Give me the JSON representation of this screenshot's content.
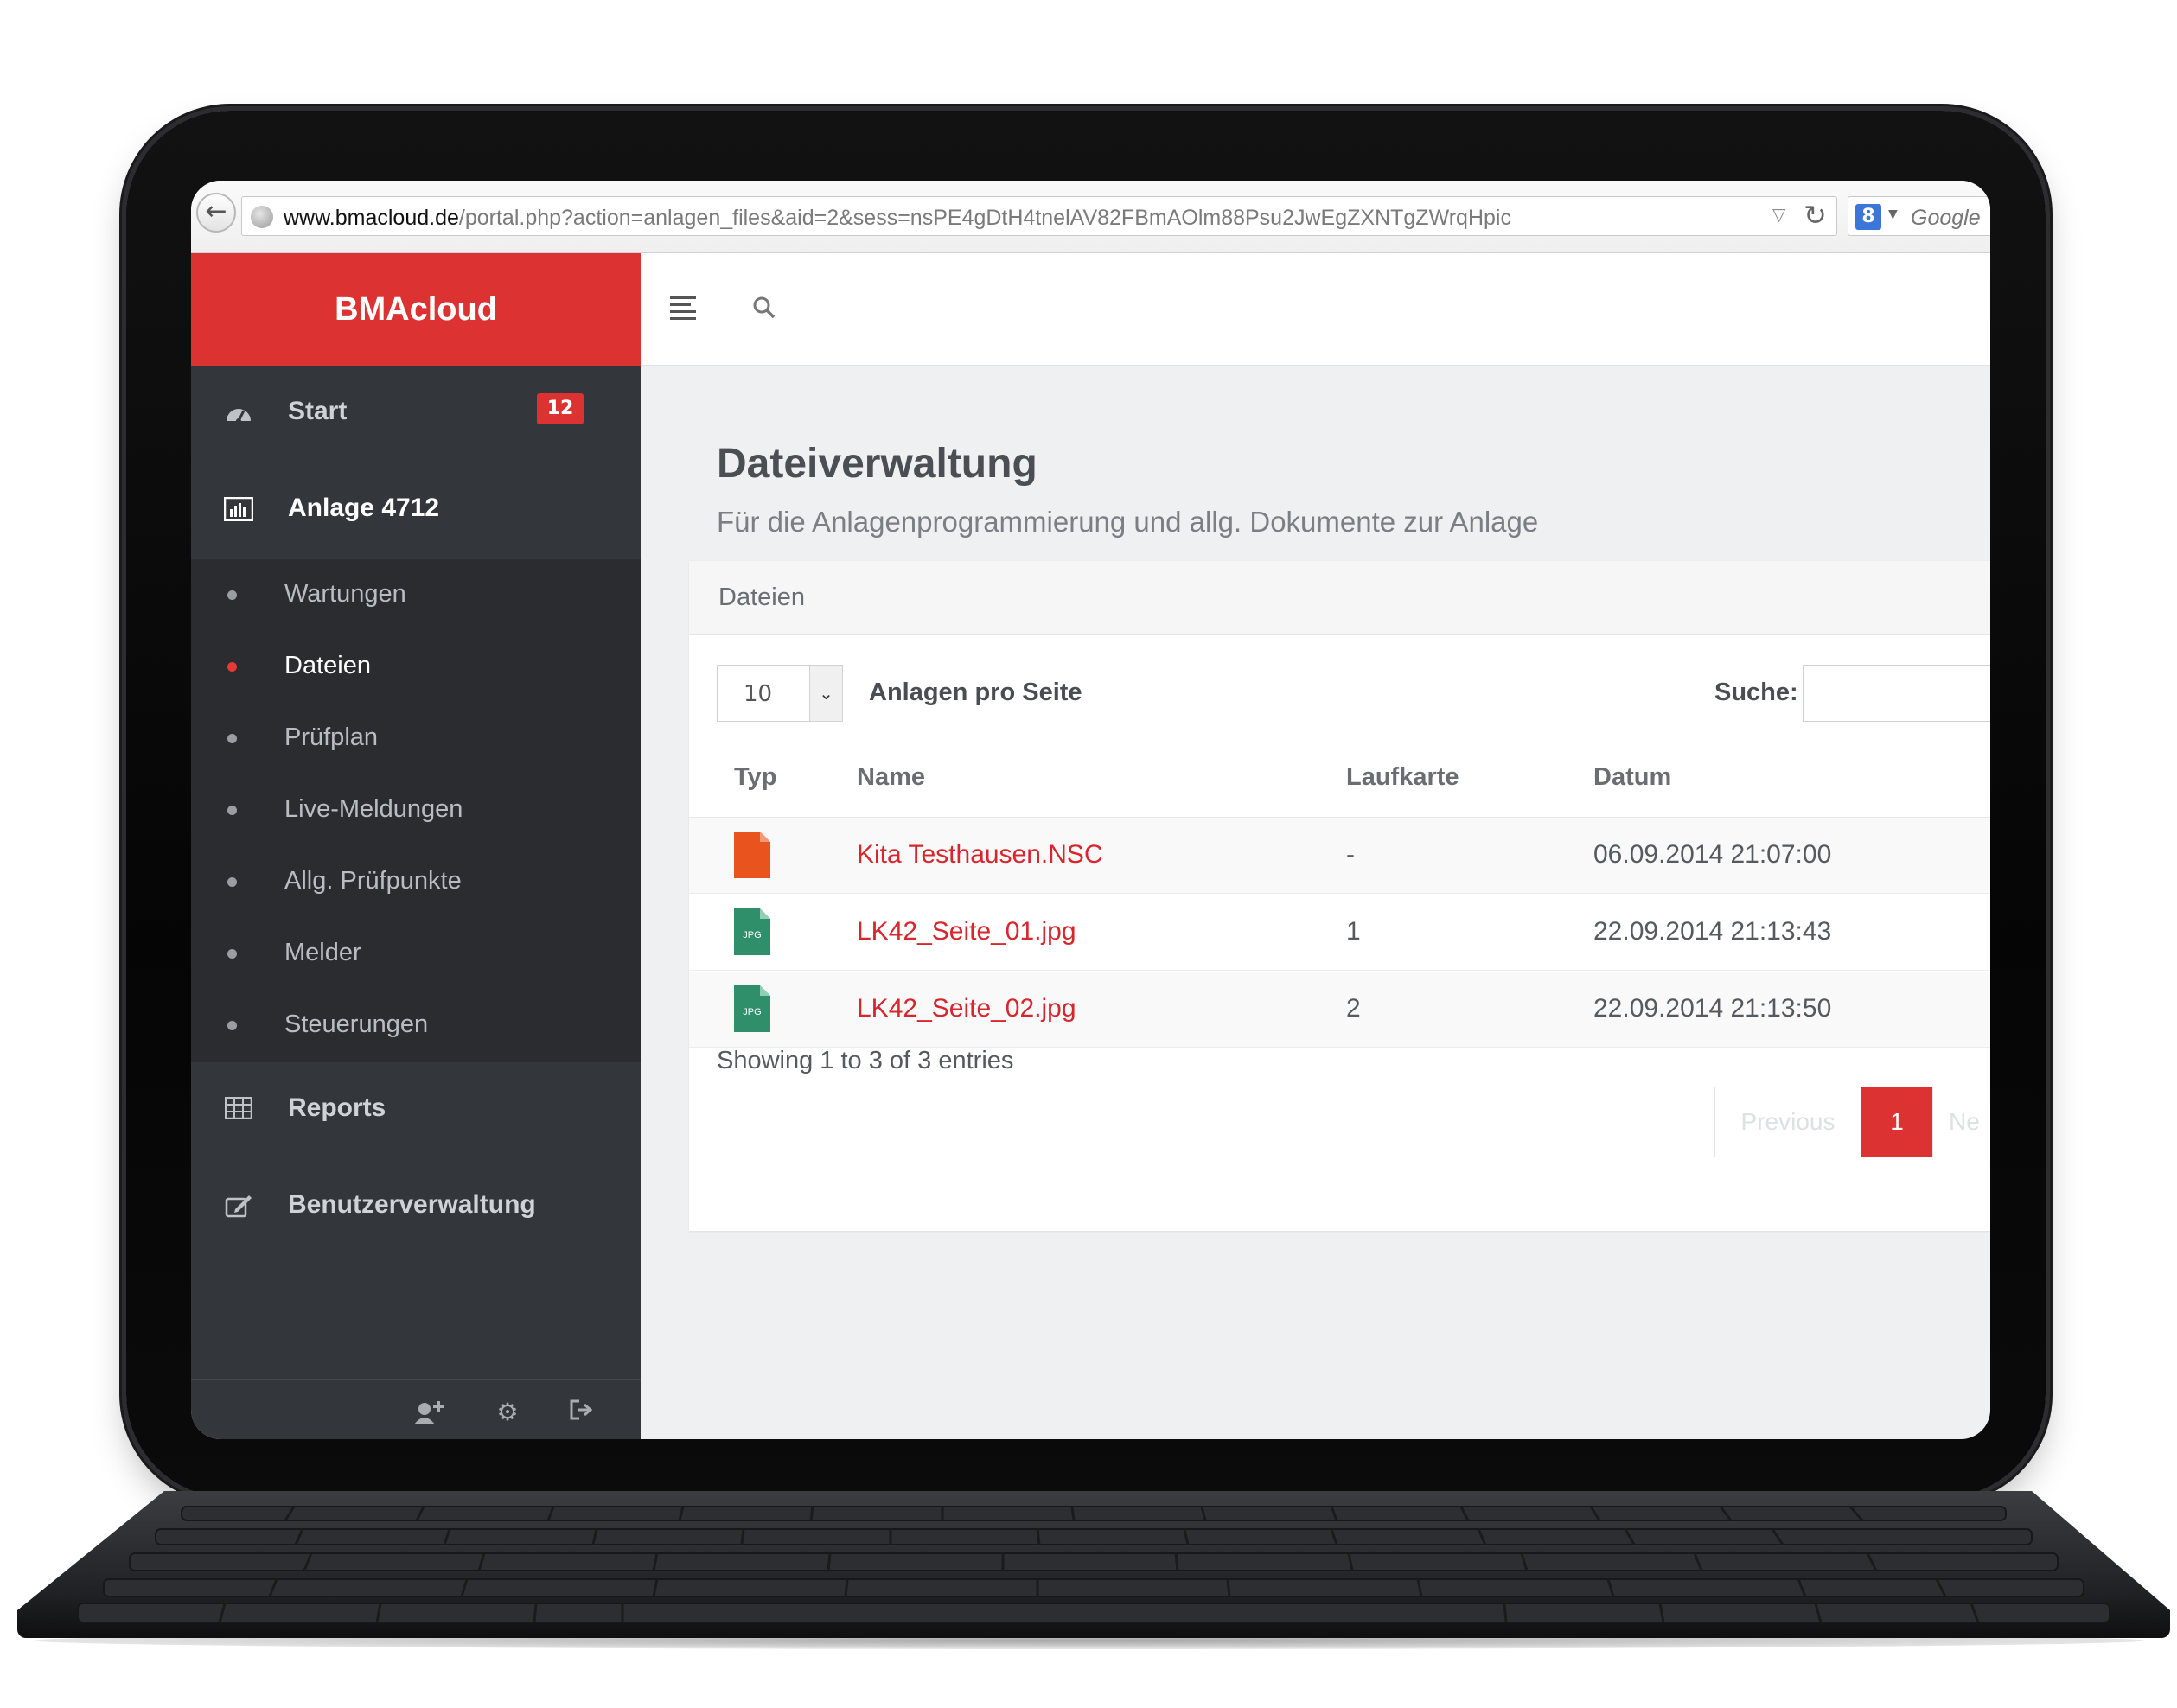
{
  "browser": {
    "url_domain": "www.bmacloud.de",
    "url_path": "/portal.php?action=anlagen_files&aid=2&sess=nsPE4gDtH4tnelAV82FBmAOlm88Psu2JwEgZXNTgZWrqHpic",
    "search_engine_letter": "8",
    "search_placeholder": "Google"
  },
  "sidebar": {
    "brand": "BMAcloud",
    "nav": [
      {
        "label": "Start",
        "icon": "dashboard-icon",
        "badge": "12"
      },
      {
        "label": "Anlage 4712",
        "icon": "bar-chart-icon",
        "active": true
      },
      {
        "label": "Reports",
        "icon": "table-icon"
      },
      {
        "label": "Benutzerverwaltung",
        "icon": "edit-icon"
      }
    ],
    "submenu": [
      {
        "label": "Wartungen"
      },
      {
        "label": "Dateien",
        "active": true
      },
      {
        "label": "Prüfplan"
      },
      {
        "label": "Live-Meldungen"
      },
      {
        "label": "Allg. Prüfpunkte"
      },
      {
        "label": "Melder"
      },
      {
        "label": "Steuerungen"
      }
    ],
    "footer_icons": [
      "add-user-icon",
      "gear-icon",
      "logout-icon"
    ]
  },
  "topbar": {
    "icons": [
      "menu-icon",
      "search-icon"
    ]
  },
  "page": {
    "title": "Dateiverwaltung",
    "subtitle": "Für die Anlagenprogrammierung und allg. Dokumente zur Anlage"
  },
  "panel": {
    "heading": "Dateien",
    "page_length_value": "10",
    "page_length_label": "Anlagen pro Seite",
    "search_label": "Suche:",
    "columns": [
      "Typ",
      "Name",
      "Laufkarte",
      "Datum"
    ],
    "rows": [
      {
        "type_icon": "nsc-file-icon",
        "type_color": "#e8531e",
        "name": "Kita Testhausen.NSC",
        "laufkarte": "-",
        "datum": "06.09.2014 21:07:00"
      },
      {
        "type_icon": "jpg-file-icon",
        "type_color": "#2e8f6a",
        "type_label": "JPG",
        "name": "LK42_Seite_01.jpg",
        "laufkarte": "1",
        "datum": "22.09.2014 21:13:43"
      },
      {
        "type_icon": "jpg-file-icon",
        "type_color": "#2e8f6a",
        "type_label": "JPG",
        "name": "LK42_Seite_02.jpg",
        "laufkarte": "2",
        "datum": "22.09.2014 21:13:50"
      }
    ],
    "info": "Showing 1 to 3 of 3 entries",
    "pagination": {
      "previous": "Previous",
      "current": "1",
      "next": "Ne"
    }
  },
  "colors": {
    "accent": "#dc3232",
    "sidebar_bg": "#33363b",
    "submenu_bg": "#2a2c30",
    "link": "#d8262e"
  }
}
